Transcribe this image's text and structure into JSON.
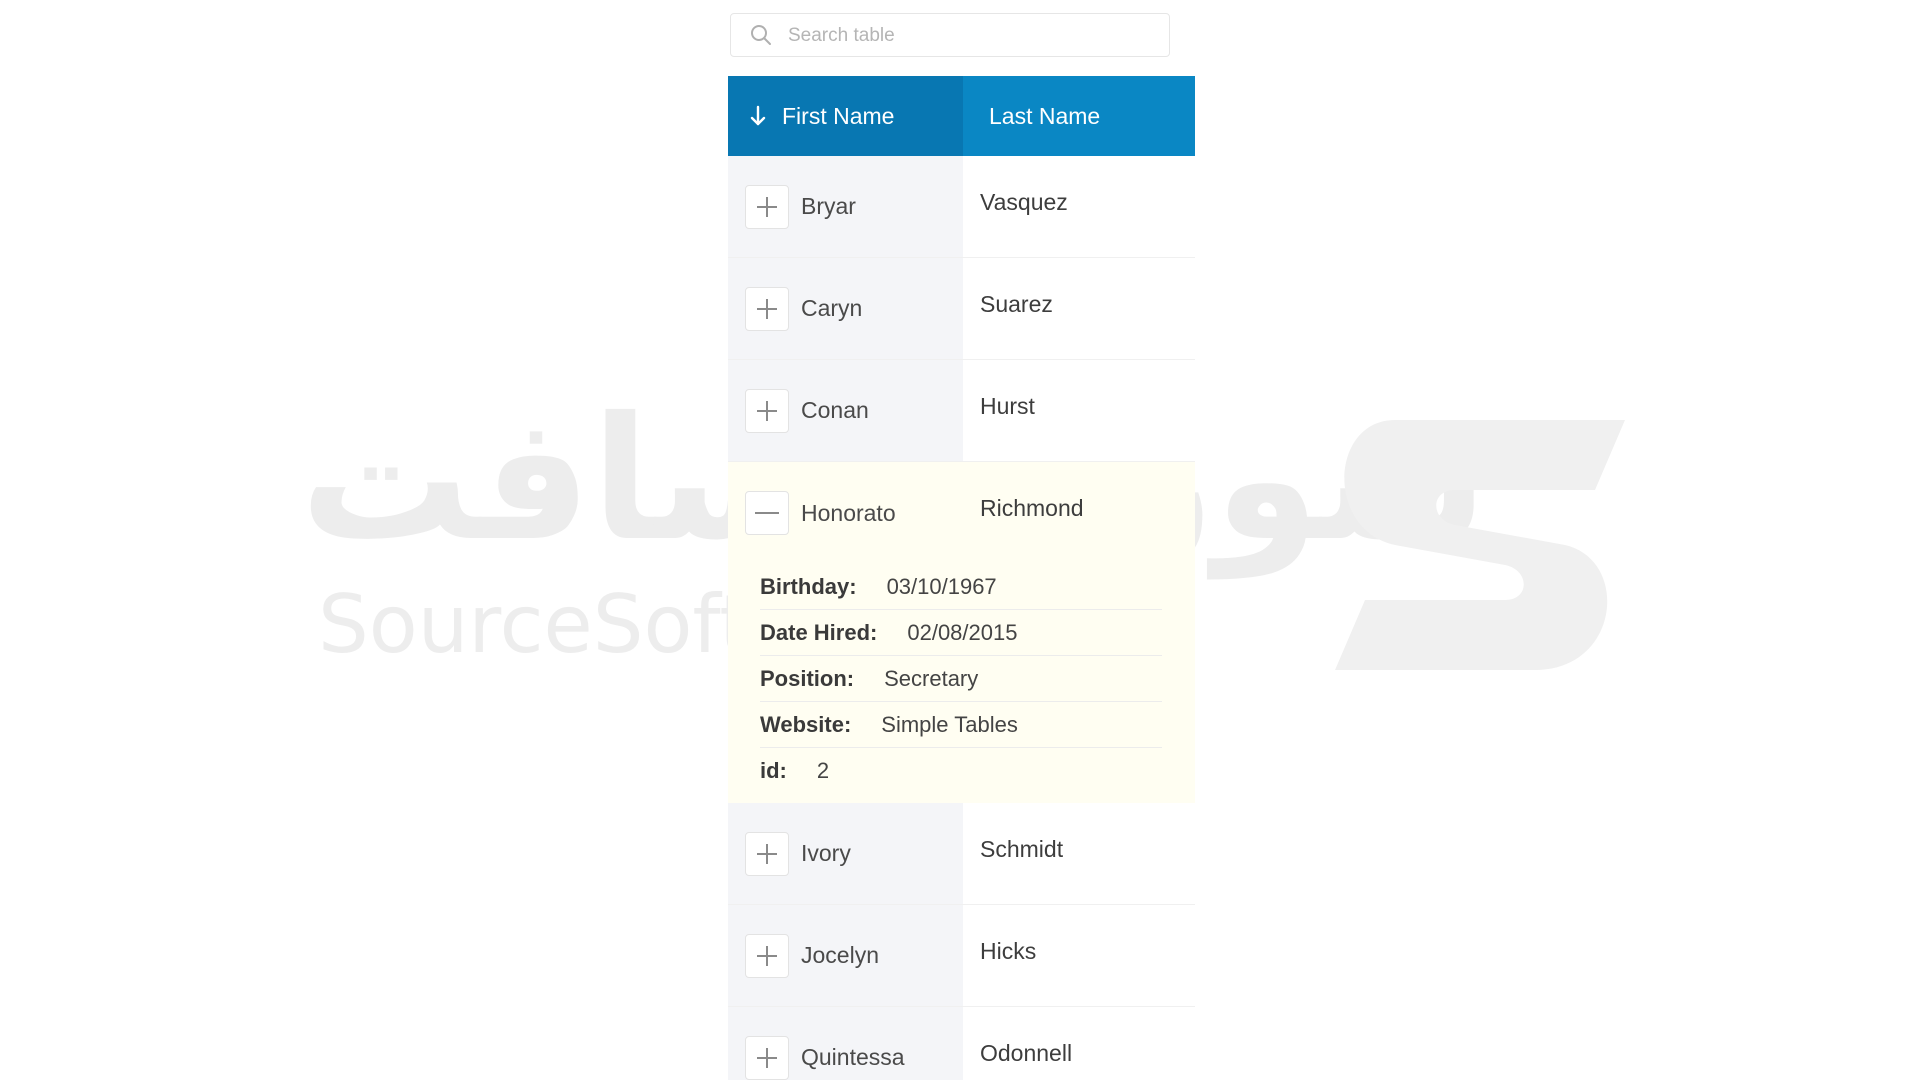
{
  "watermark": {
    "arabic": "سورس سافت",
    "latin": "SourceSoft"
  },
  "search": {
    "placeholder": "Search table",
    "value": "",
    "icon": "search-icon"
  },
  "table": {
    "sorted_column": "First Name",
    "sort_direction": "descending-arrow",
    "headers": {
      "first": "First Name",
      "last": "Last Name"
    },
    "rows": [
      {
        "first": "Bryar",
        "last": "Vasquez",
        "expanded": false
      },
      {
        "first": "Caryn",
        "last": "Suarez",
        "expanded": false
      },
      {
        "first": "Conan",
        "last": "Hurst",
        "expanded": false
      },
      {
        "first": "Honorato",
        "last": "Richmond",
        "expanded": true
      },
      {
        "first": "Ivory",
        "last": "Schmidt",
        "expanded": false
      },
      {
        "first": "Jocelyn",
        "last": "Hicks",
        "expanded": false
      },
      {
        "first": "Quintessa",
        "last": "Odonnell",
        "expanded": false
      }
    ],
    "details": {
      "birthday_label": "Birthday:",
      "birthday": "03/10/1967",
      "date_hired_label": "Date Hired:",
      "date_hired": "02/08/2015",
      "position_label": "Position:",
      "position": "Secretary",
      "website_label": "Website:",
      "website": "Simple Tables",
      "id_label": "id:",
      "id": "2"
    }
  },
  "colors": {
    "header_bg": "#0a87c4",
    "header_sorted_bg": "#0877b2",
    "first_col_bg": "#f4f5f8",
    "expanded_bg": "#fffef2"
  }
}
